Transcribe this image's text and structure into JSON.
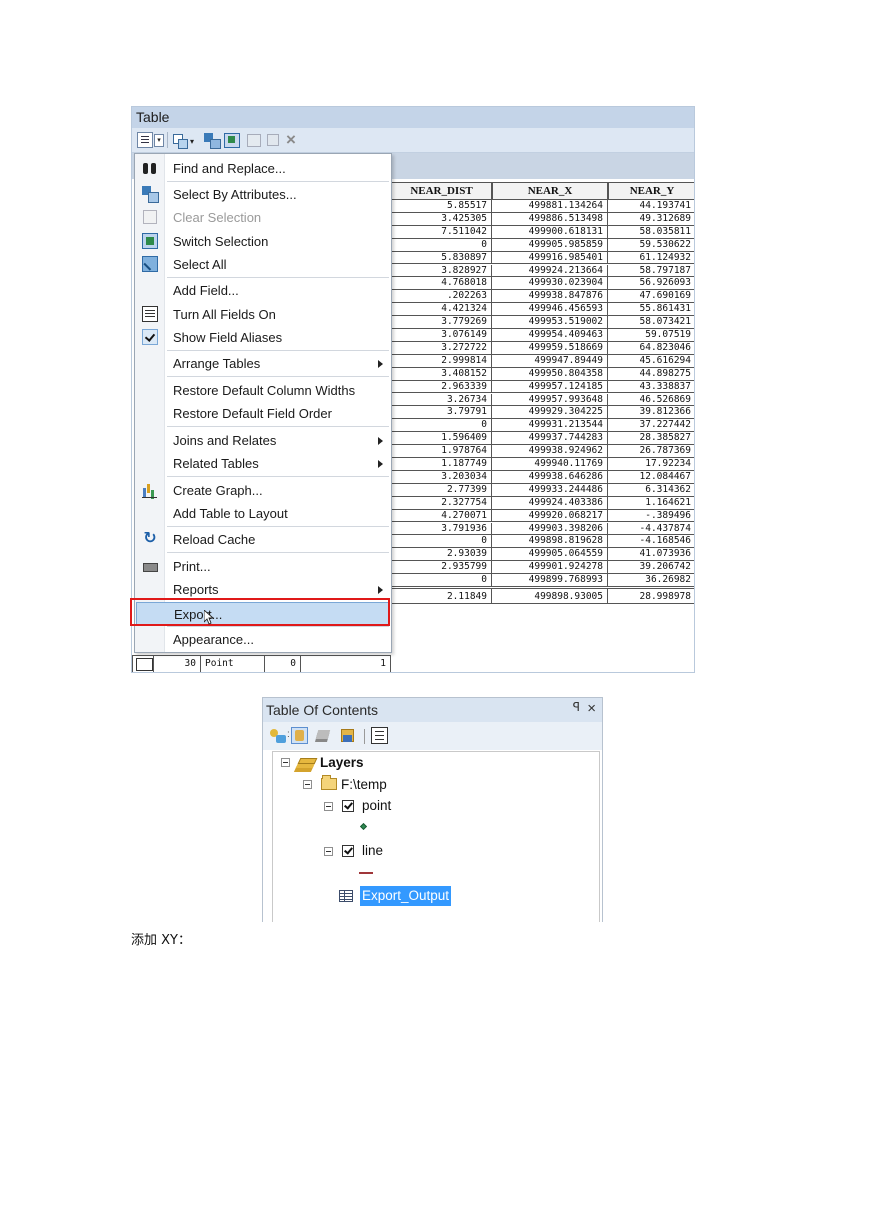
{
  "table_window": {
    "title": "Table",
    "toolbar": {
      "dropdown_arrow": "▾",
      "close_symbol": "×"
    },
    "columns": [
      "NEAR_DIST",
      "NEAR_X",
      "NEAR_Y"
    ],
    "rows": [
      [
        "5.85517",
        "499881.134264",
        "44.193741"
      ],
      [
        "3.425305",
        "499886.513498",
        "49.312689"
      ],
      [
        "7.511042",
        "499900.618131",
        "58.035811"
      ],
      [
        "0",
        "499905.985859",
        "59.530622"
      ],
      [
        "5.830897",
        "499916.985401",
        "61.124932"
      ],
      [
        "3.828927",
        "499924.213664",
        "58.797187"
      ],
      [
        "4.768018",
        "499930.023904",
        "56.926093"
      ],
      [
        ".202263",
        "499938.847876",
        "47.690169"
      ],
      [
        "4.421324",
        "499946.456593",
        "55.861431"
      ],
      [
        "3.779269",
        "499953.519002",
        "58.073421"
      ],
      [
        "3.076149",
        "499954.409463",
        "59.07519"
      ],
      [
        "3.272722",
        "499959.518669",
        "64.823046"
      ],
      [
        "2.999814",
        "499947.89449",
        "45.616294"
      ],
      [
        "3.408152",
        "499950.804358",
        "44.898275"
      ],
      [
        "2.963339",
        "499957.124185",
        "43.338837"
      ],
      [
        "3.26734",
        "499957.993648",
        "46.526869"
      ],
      [
        "3.79791",
        "499929.304225",
        "39.812366"
      ],
      [
        "0",
        "499931.213544",
        "37.227442"
      ],
      [
        "1.596409",
        "499937.744283",
        "28.385827"
      ],
      [
        "1.978764",
        "499938.924962",
        "26.787369"
      ],
      [
        "1.187749",
        "499940.11769",
        "17.92234"
      ],
      [
        "3.203034",
        "499938.646286",
        "12.084467"
      ],
      [
        "2.77399",
        "499933.244486",
        "6.314362"
      ],
      [
        "2.327754",
        "499924.403386",
        "1.164621"
      ],
      [
        "4.270071",
        "499920.068217",
        "-.389496"
      ],
      [
        "3.791936",
        "499903.398206",
        "-4.437874"
      ],
      [
        "0",
        "499898.819628",
        "-4.168546"
      ],
      [
        "2.93039",
        "499905.064559",
        "41.073936"
      ],
      [
        "2.935799",
        "499901.924278",
        "39.206742"
      ],
      [
        "0",
        "499899.768993",
        "36.26982"
      ]
    ],
    "last_row": {
      "fid": "30",
      "shape": "Point",
      "col_a": "0",
      "col_b": "1",
      "near_dist": "2.11849",
      "near_x": "499898.93005",
      "near_y": "28.998978"
    }
  },
  "context_menu": {
    "items": [
      {
        "label": "Find and Replace...",
        "icon": "binoculars-icon"
      },
      {
        "label": "Select By Attributes...",
        "icon": "select-by-attributes-icon"
      },
      {
        "label": "Clear Selection",
        "icon": "clear-selection-icon",
        "disabled": true
      },
      {
        "label": "Switch Selection",
        "icon": "switch-selection-icon"
      },
      {
        "label": "Select All",
        "icon": "select-all-icon"
      },
      {
        "label": "Add Field..."
      },
      {
        "label": "Turn All Fields On",
        "icon": "fields-icon"
      },
      {
        "label": "Show Field Aliases",
        "icon": "checkmark-icon",
        "checked": true
      },
      {
        "label": "Arrange Tables",
        "submenu": true
      },
      {
        "label": "Restore Default Column Widths"
      },
      {
        "label": "Restore Default Field Order"
      },
      {
        "label": "Joins and Relates",
        "submenu": true
      },
      {
        "label": "Related Tables",
        "submenu": true
      },
      {
        "label": "Create Graph...",
        "icon": "graph-icon"
      },
      {
        "label": "Add Table to Layout"
      },
      {
        "label": "Reload Cache",
        "icon": "reload-icon"
      },
      {
        "label": "Print...",
        "icon": "printer-icon"
      },
      {
        "label": "Reports",
        "submenu": true
      },
      {
        "label": "Export...",
        "highlighted": true
      },
      {
        "label": "Appearance..."
      }
    ],
    "highlight_color": "#e01919"
  },
  "toc": {
    "title": "Table Of Contents",
    "pin_symbol": "ꟼ",
    "close_symbol": "×",
    "tree": {
      "root": "Layers",
      "folder": "F:\\temp",
      "layer_point": "point",
      "layer_line": "line",
      "table": "Export_Output"
    },
    "selection_color": "#3399ff"
  },
  "caption": "添加 XY："
}
